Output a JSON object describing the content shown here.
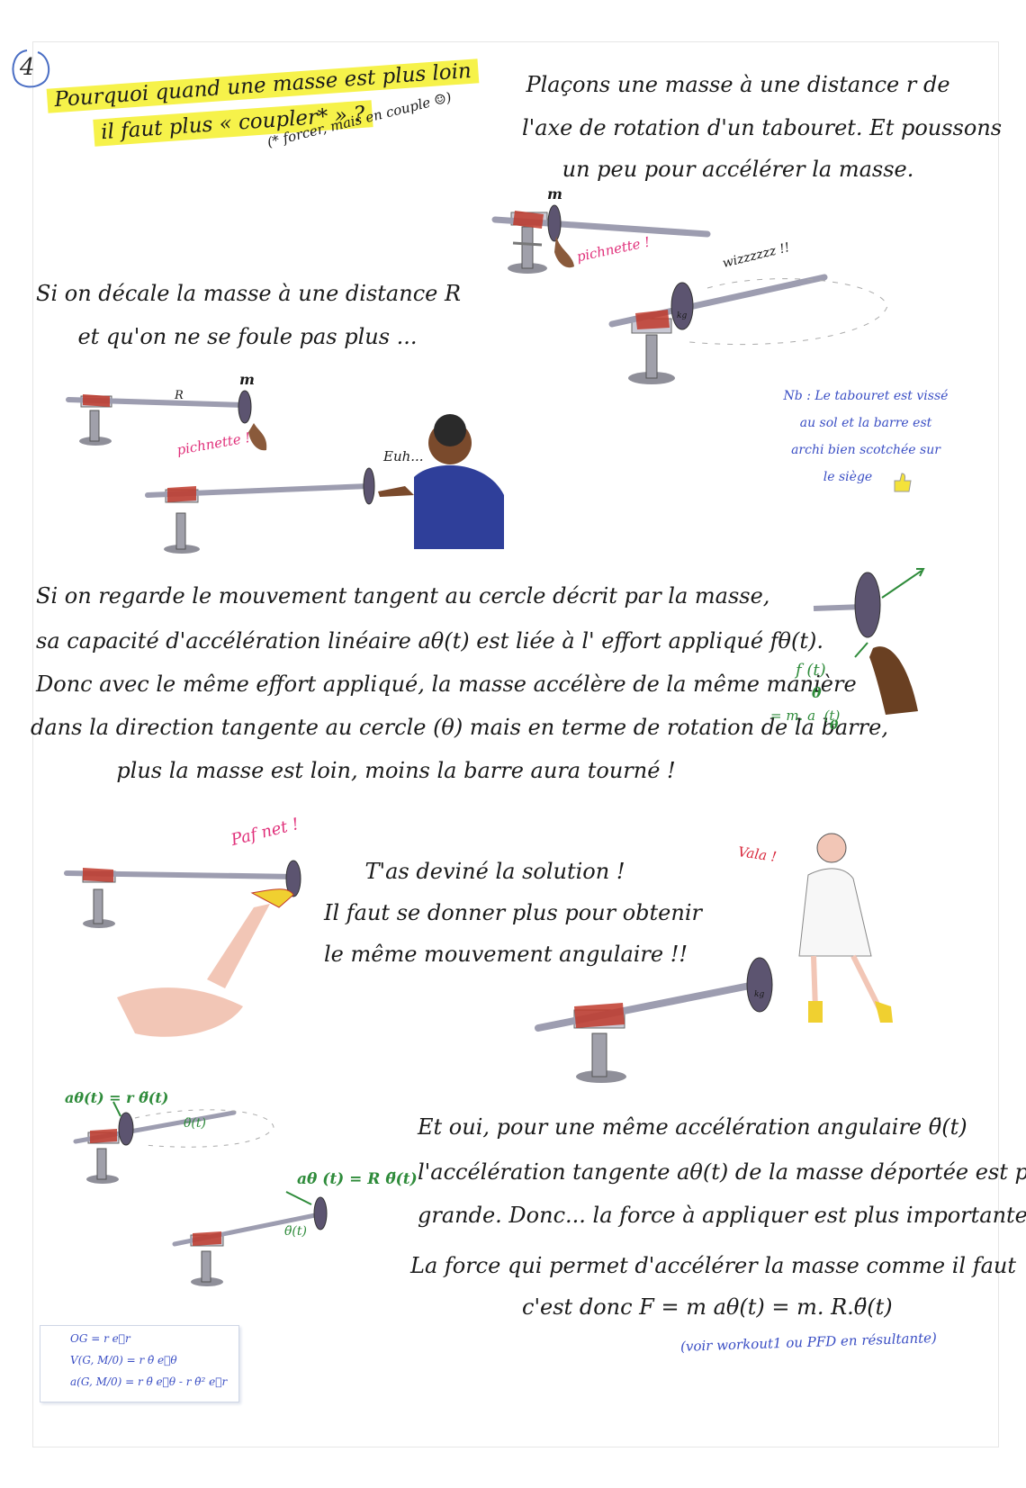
{
  "number": "4",
  "title": {
    "line1": "Pourquoi quand une masse est plus loin",
    "line2": "il faut plus « coupler* » ?",
    "aside": "(* forcer, mais en couple ☺)"
  },
  "intro": [
    "Plaçons une masse à une distance r de",
    "l'axe de rotation d'un tabouret. Et poussons",
    "un peu pour accélérer la masse."
  ],
  "labels": {
    "m1": "m",
    "pichnette1": "pichnette !",
    "wizz": "wizzzzzz !!",
    "m2": "m",
    "R": "R",
    "pichnette2": "pichnette !",
    "euh": "Euh...",
    "paf": "Paf net !",
    "vala": "Vala !",
    "kg1": "kg",
    "kg2": "kg"
  },
  "section2": [
    "Si on décale la masse à une distance R",
    "et qu'on ne se foule pas plus ..."
  ],
  "nb": [
    "Nb : Le tabouret est vissé",
    "au sol et la barre est",
    "archi bien scotchée sur",
    "le siège"
  ],
  "section3": [
    "Si on regarde le mouvement tangent au cercle décrit par la masse,",
    "sa capacité d'accélération linéaire aθ(t) est liée à l' effort appliqué fθ(t).",
    "Donc avec le même effort appliqué, la masse accélère de la même manière",
    "dans la direction tangente au cercle (θ) mais en terme de rotation de la barre,",
    "plus la masse est loin, moins la barre aura tourné !"
  ],
  "force_note": {
    "line1": "f (t)",
    "theta": "θ",
    "line2": "= m. a  (t)",
    "theta2": "θ"
  },
  "section4": [
    "T'as deviné la solution !",
    "Il faut se donner plus pour obtenir",
    "le même mouvement angulaire !!"
  ],
  "formula_small_r": "aθ(t) = r θ̈(t)",
  "formula_small_r_theta": "θ̈(t)",
  "formula_big_R": "aθ (t) = R θ̈(t)",
  "formula_big_R_theta": "θ̈(t)",
  "kinematics": [
    "OG = r e⃗r",
    "V(G, M/0) = r θ̇ e⃗θ",
    "a(G, M/0) = r θ̈ e⃗θ - r θ̇² e⃗r"
  ],
  "section5": [
    "Et oui, pour une même accélération angulaire θ̈(t)",
    "l'accélération tangente aθ(t) de la masse déportée est plus",
    "grande. Donc... la force à appliquer est plus importante",
    "La force qui permet d'accélérer la masse comme il faut",
    "c'est donc F = m aθ(t) = m. R.θ̈(t)"
  ],
  "footnote": "(voir workout1 ou PFD en résultante)",
  "colors": {
    "highlight": "#f6f24a",
    "pink": "#e0307a",
    "green": "#2e8b3a",
    "blue": "#3a4ec4",
    "red": "#d8263a"
  }
}
